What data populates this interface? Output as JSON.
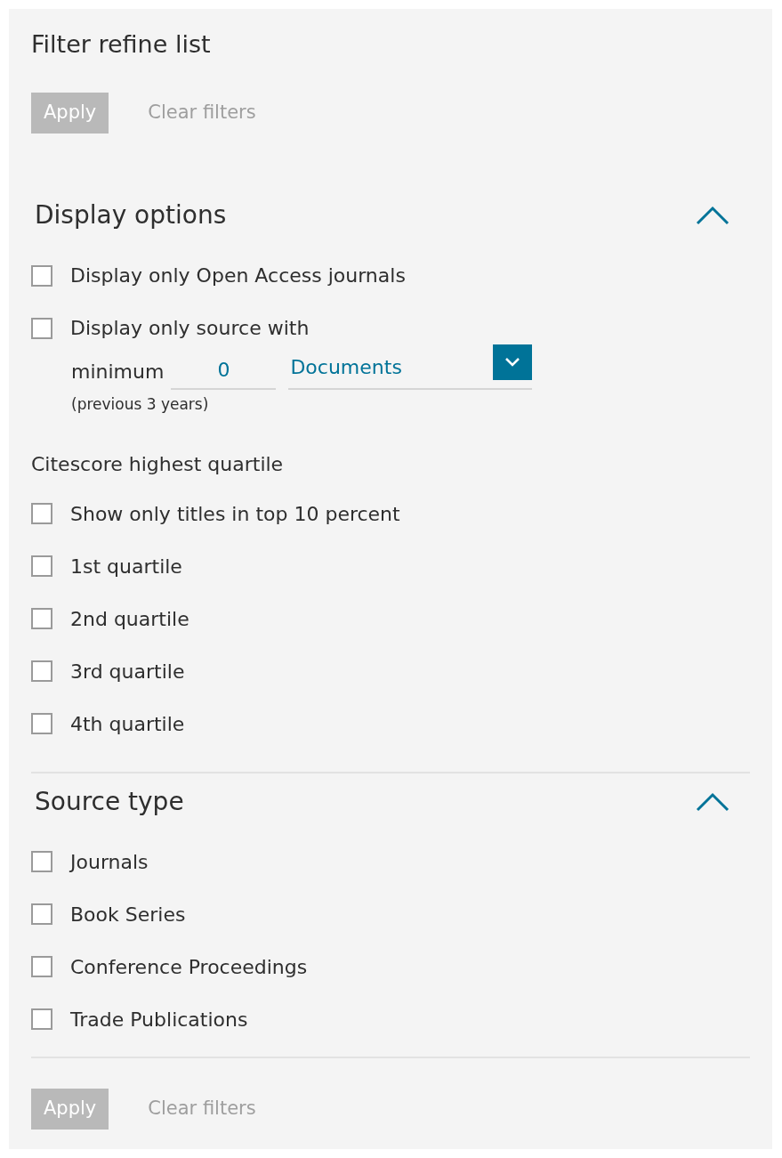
{
  "title": "Filter refine list",
  "top_actions": {
    "apply": {
      "label": "Apply",
      "disabled": true
    },
    "clear": {
      "label": "Clear filters",
      "disabled": true
    }
  },
  "sections": [
    {
      "title": "Display options",
      "expanded": true,
      "items": [
        {
          "kind": "checkbox",
          "label": "Display only Open Access journals",
          "checked": false
        },
        {
          "kind": "min-docs",
          "label": "Display only source with",
          "checked": false,
          "prefix": "minimum",
          "value": "0",
          "select": "Documents",
          "note": "(previous 3 years)"
        },
        {
          "kind": "heading",
          "label": "Citescore highest quartile"
        },
        {
          "kind": "checkbox",
          "label": "Show only titles in top 10 percent",
          "checked": false
        },
        {
          "kind": "checkbox",
          "label": "1st quartile",
          "checked": false
        },
        {
          "kind": "checkbox",
          "label": "2nd quartile",
          "checked": false
        },
        {
          "kind": "checkbox",
          "label": "3rd quartile",
          "checked": false
        },
        {
          "kind": "checkbox",
          "label": "4th quartile",
          "checked": false
        }
      ]
    },
    {
      "title": "Source type",
      "expanded": true,
      "items": [
        {
          "kind": "checkbox",
          "label": "Journals",
          "checked": false
        },
        {
          "kind": "checkbox",
          "label": "Book Series",
          "checked": false
        },
        {
          "kind": "checkbox",
          "label": "Conference Proceedings",
          "checked": false
        },
        {
          "kind": "checkbox",
          "label": "Trade Publications",
          "checked": false
        }
      ]
    }
  ],
  "bottom_actions": {
    "apply": {
      "label": "Apply",
      "disabled": true
    },
    "clear": {
      "label": "Clear filters",
      "disabled": true
    }
  }
}
